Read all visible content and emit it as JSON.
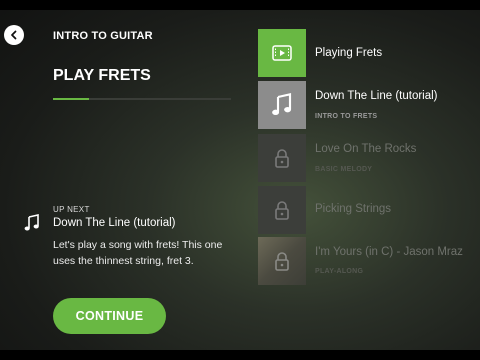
{
  "header": {
    "course_title": "INTRO TO GUITAR",
    "lesson_title": "PLAY FRETS",
    "progress": 0.2
  },
  "up_next": {
    "label": "UP NEXT",
    "title": "Down The Line (tutorial)",
    "description": "Let's play a song with frets! This one uses the thinnest string, fret 3."
  },
  "continue_label": "CONTINUE",
  "colors": {
    "accent": "#69b843"
  },
  "lessons": [
    {
      "title": "Playing Frets",
      "subtitle": "",
      "icon": "video-icon",
      "state": "current"
    },
    {
      "title": "Down The Line (tutorial)",
      "subtitle": "INTRO TO FRETS",
      "icon": "music-note-icon",
      "state": "next"
    },
    {
      "title": "Love On The Rocks",
      "subtitle": "BASIC MELODY",
      "icon": "lock-icon",
      "state": "locked"
    },
    {
      "title": "Picking Strings",
      "subtitle": "",
      "icon": "lock-icon",
      "state": "locked"
    },
    {
      "title": "I'm Yours (in C) - Jason Mraz",
      "subtitle": "PLAY-ALONG",
      "icon": "lock-icon",
      "state": "locked"
    }
  ]
}
